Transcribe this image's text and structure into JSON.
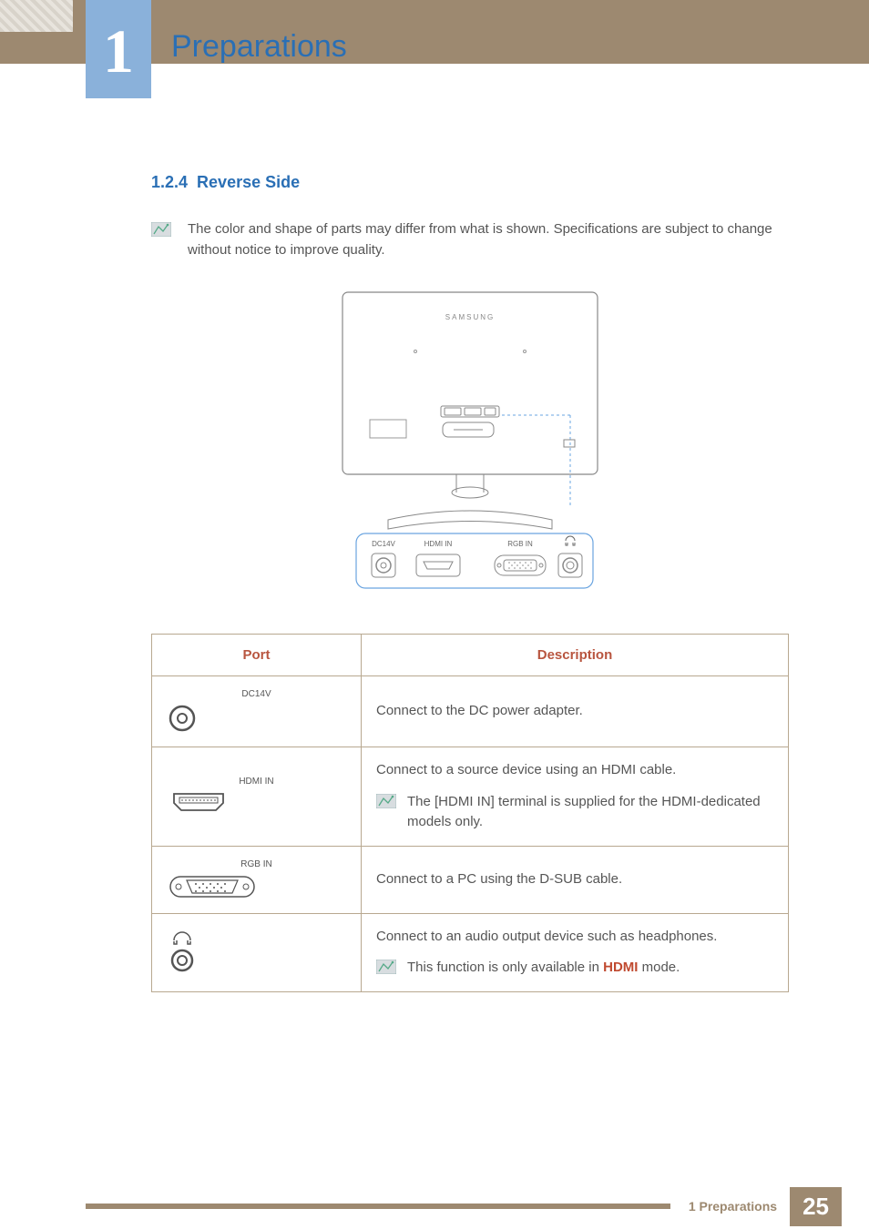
{
  "chapter": {
    "number": "1",
    "title": "Preparations"
  },
  "section": {
    "number": "1.2.4",
    "title": "Reverse Side"
  },
  "top_note": "The color and shape of parts may differ from what is shown. Specifications are subject to change without notice to improve quality.",
  "diagram": {
    "brand": "SAMSUNG",
    "labels": {
      "dc": "DC14V",
      "hdmi": "HDMI IN",
      "rgb": "RGB IN"
    }
  },
  "table": {
    "headers": {
      "port": "Port",
      "desc": "Description"
    },
    "rows": [
      {
        "label": "DC14V",
        "desc": "Connect to the DC power adapter."
      },
      {
        "label": "HDMI IN",
        "desc": "Connect to a source device using an HDMI cable.",
        "note": "The [HDMI IN] terminal is supplied for the HDMI-dedicated models only."
      },
      {
        "label": "RGB IN",
        "desc": "Connect to a PC using the D-SUB cable."
      },
      {
        "label": "",
        "desc": "Connect to an audio output device such as headphones.",
        "note_prefix": "This function is only available in ",
        "note_highlight": "HDMI",
        "note_suffix": " mode."
      }
    ]
  },
  "footer": {
    "label": "1 Preparations",
    "page": "25"
  }
}
